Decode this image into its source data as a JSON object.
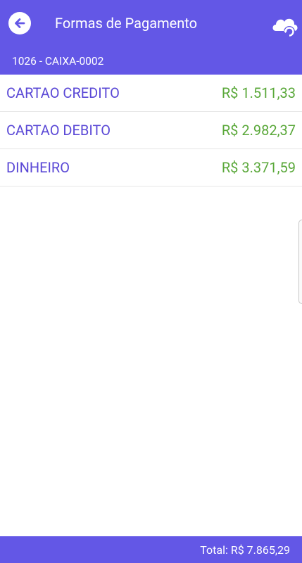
{
  "header": {
    "title": "Formas de Pagamento",
    "subtitle": "1026 - CAIXA-0002",
    "back_icon": "arrow-left-circle-icon",
    "sync_icon": "cloud-sync-icon",
    "color": "#6357e6"
  },
  "payments": [
    {
      "label": "CARTAO CREDITO",
      "value": "R$ 1.511,33"
    },
    {
      "label": "CARTAO DEBITO",
      "value": "R$ 2.982,37"
    },
    {
      "label": "DINHEIRO",
      "value": "R$ 3.371,59"
    }
  ],
  "footer": {
    "total_label": "Total:",
    "total_value": "R$ 7.865,29"
  },
  "colors": {
    "accent": "#6357e6",
    "label": "#5a48d6",
    "value": "#5aa83a"
  }
}
